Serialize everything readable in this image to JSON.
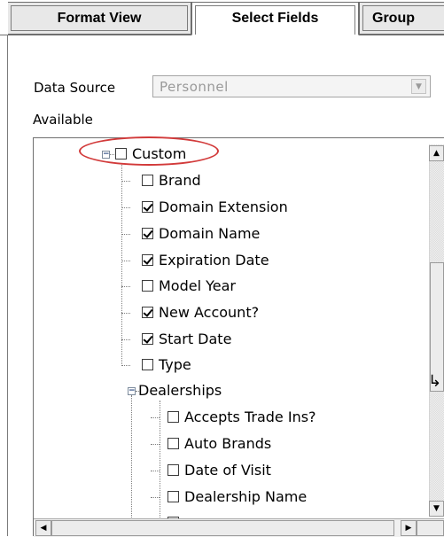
{
  "tabs": [
    {
      "label": "Format View"
    },
    {
      "label": "Select Fields"
    },
    {
      "label": "Group"
    }
  ],
  "data_source": {
    "label": "Data Source",
    "value": "Personnel"
  },
  "available_label": "Available",
  "tree": {
    "custom": {
      "label": "Custom",
      "checked": false,
      "fields": [
        {
          "label": "Brand",
          "checked": false
        },
        {
          "label": "Domain Extension",
          "checked": true
        },
        {
          "label": "Domain Name",
          "checked": true
        },
        {
          "label": "Expiration Date",
          "checked": true
        },
        {
          "label": "Model Year",
          "checked": false
        },
        {
          "label": "New Account?",
          "checked": true
        },
        {
          "label": "Start Date",
          "checked": true
        },
        {
          "label": "Type",
          "checked": false
        }
      ]
    },
    "dealerships": {
      "label": "Dealerships",
      "fields": [
        {
          "label": "Accepts Trade Ins?",
          "checked": false
        },
        {
          "label": "Auto Brands",
          "checked": false
        },
        {
          "label": "Date of Visit",
          "checked": false
        },
        {
          "label": "Dealership Name",
          "checked": false
        }
      ]
    }
  },
  "highlight_color": "#d23a3a"
}
